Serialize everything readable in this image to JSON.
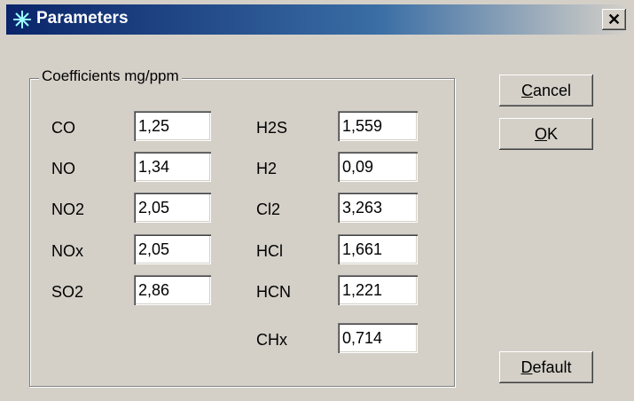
{
  "window": {
    "title": "Parameters",
    "close_glyph": "✕"
  },
  "group": {
    "label": "Coefficients mg/ppm"
  },
  "left_column": [
    {
      "label": "CO",
      "value": "1,25"
    },
    {
      "label": "NO",
      "value": "1,34"
    },
    {
      "label": "NO2",
      "value": "2,05"
    },
    {
      "label": "NOx",
      "value": "2,05"
    },
    {
      "label": "SO2",
      "value": "2,86"
    }
  ],
  "right_column": [
    {
      "label": "H2S",
      "value": "1,559"
    },
    {
      "label": "H2",
      "value": "0,09"
    },
    {
      "label": "Cl2",
      "value": "3,263"
    },
    {
      "label": "HCl",
      "value": "1,661"
    },
    {
      "label": "HCN",
      "value": "1,221"
    },
    {
      "label": "CHx",
      "value": "0,714"
    }
  ],
  "buttons": {
    "cancel": {
      "mnemonic": "C",
      "rest": "ancel"
    },
    "ok": {
      "mnemonic": "O",
      "rest": "K"
    },
    "default": {
      "mnemonic": "D",
      "rest": "efault"
    }
  },
  "icons": {
    "title": "snowflake-icon",
    "close": "close-icon"
  }
}
